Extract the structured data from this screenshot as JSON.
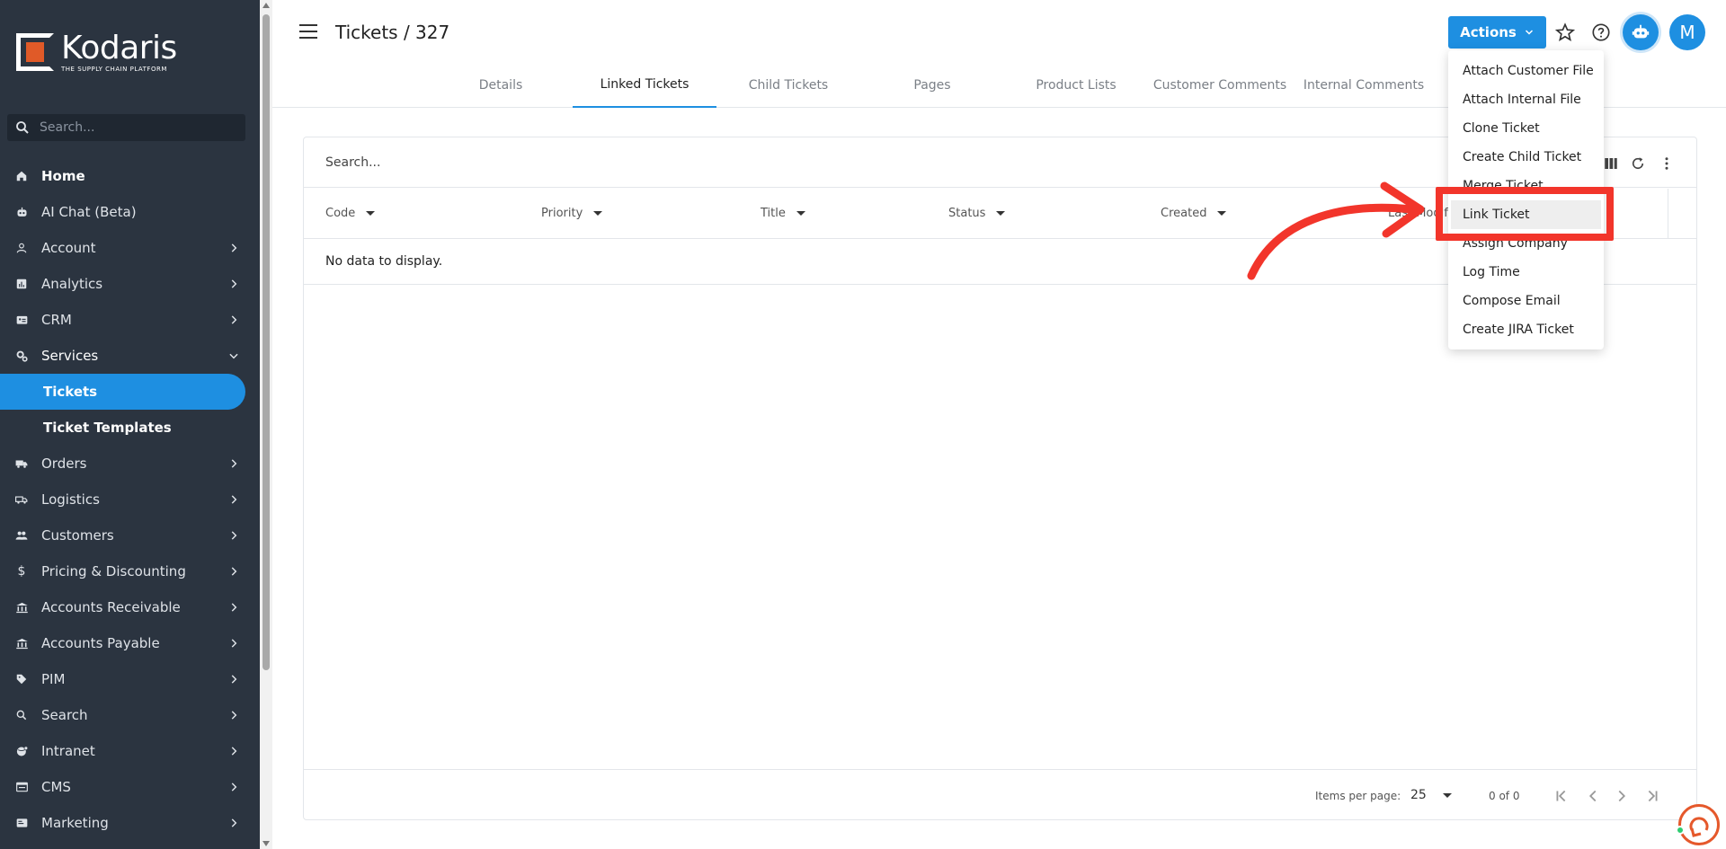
{
  "brand": {
    "name": "Kodaris",
    "tagline": "THE SUPPLY CHAIN PLATFORM"
  },
  "sidebar": {
    "search_placeholder": "Search...",
    "items": [
      {
        "label": "Home",
        "icon": "home-icon"
      },
      {
        "label": "AI Chat (Beta)",
        "icon": "robot-icon"
      },
      {
        "label": "Account",
        "icon": "person-icon"
      },
      {
        "label": "Analytics",
        "icon": "analytics-icon"
      },
      {
        "label": "CRM",
        "icon": "crm-icon"
      },
      {
        "label": "Services",
        "icon": "gears-icon"
      },
      {
        "label": "Tickets"
      },
      {
        "label": "Ticket Templates"
      },
      {
        "label": "Orders",
        "icon": "truck-icon"
      },
      {
        "label": "Logistics",
        "icon": "shipping-icon"
      },
      {
        "label": "Customers",
        "icon": "people-icon"
      },
      {
        "label": "Pricing & Discounting",
        "icon": "dollar-icon"
      },
      {
        "label": "Accounts Receivable",
        "icon": "bank-icon"
      },
      {
        "label": "Accounts Payable",
        "icon": "bank-icon"
      },
      {
        "label": "PIM",
        "icon": "tag-icon"
      },
      {
        "label": "Search",
        "icon": "search-icon"
      },
      {
        "label": "Intranet",
        "icon": "globe-icon"
      },
      {
        "label": "CMS",
        "icon": "cms-icon"
      },
      {
        "label": "Marketing",
        "icon": "marketing-icon"
      }
    ]
  },
  "header": {
    "title": "Tickets / 327",
    "actions_label": "Actions",
    "avatar_initial": "M",
    "tabs": [
      {
        "label": "Details"
      },
      {
        "label": "Linked Tickets"
      },
      {
        "label": "Child Tickets"
      },
      {
        "label": "Pages"
      },
      {
        "label": "Product Lists"
      },
      {
        "label": "Customer Comments"
      },
      {
        "label": "Internal Comments"
      }
    ]
  },
  "table": {
    "search_placeholder": "Search...",
    "columns": [
      "Code",
      "Priority",
      "Title",
      "Status",
      "Created",
      "Last Modifie"
    ],
    "empty_text": "No data to display.",
    "pager": {
      "items_per_page_label": "Items per page:",
      "items_per_page": "25",
      "range": "0 of 0"
    }
  },
  "actions_menu": {
    "items": [
      "Attach Customer File",
      "Attach Internal File",
      "Clone Ticket",
      "Create Child Ticket",
      "Merge Ticket",
      "Link Ticket",
      "Assign Company",
      "Log Time",
      "Compose Email",
      "Create JIRA Ticket"
    ]
  },
  "colors": {
    "sidebar_bg": "#2b3440",
    "accent": "#1e8fe1",
    "annotation": "#f2352b",
    "brand_orange": "#e05a28"
  }
}
